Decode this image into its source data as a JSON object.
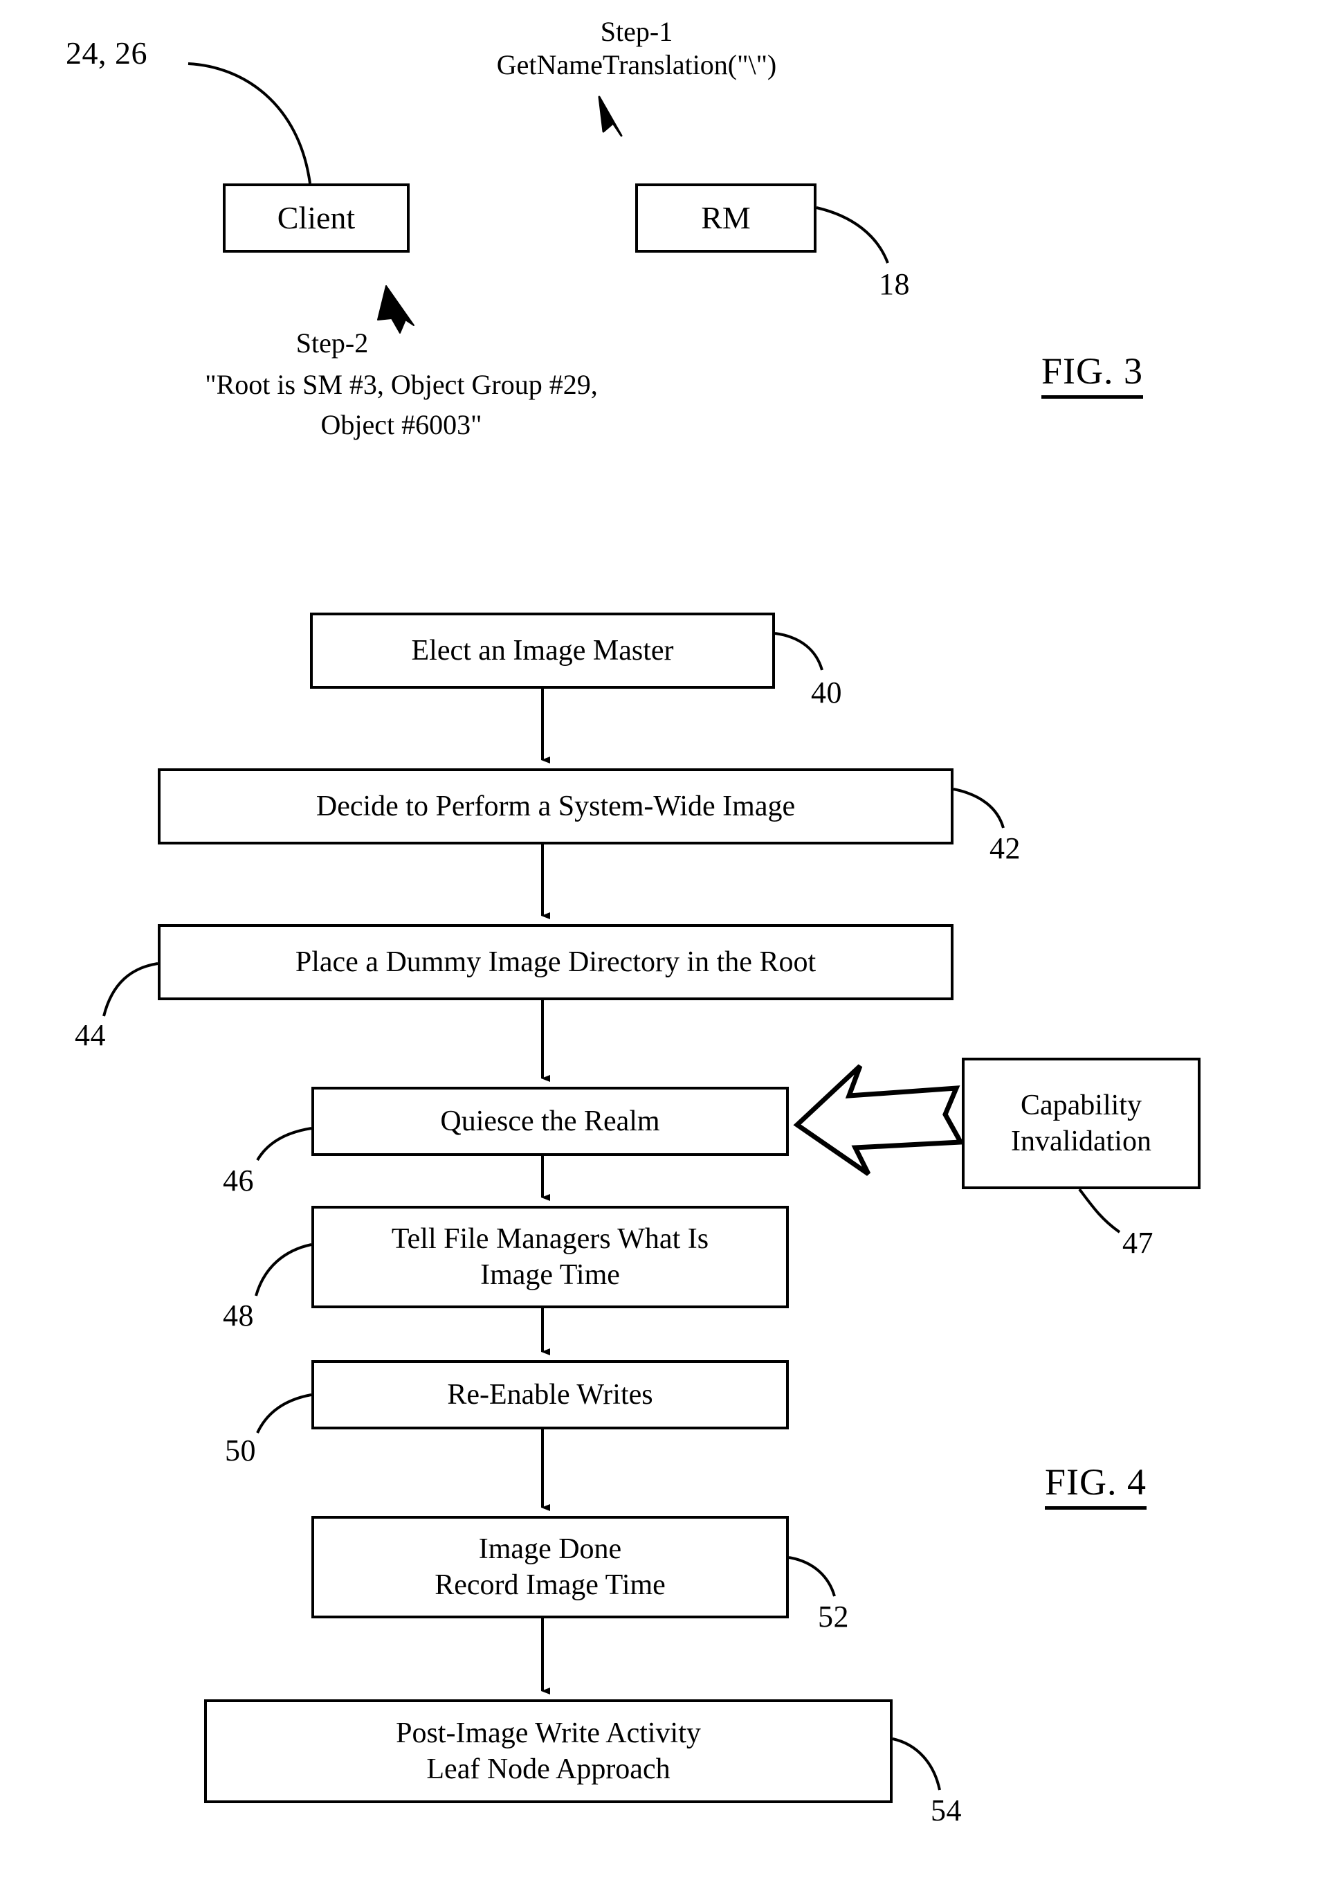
{
  "document": {
    "kind": "patent-drawing-sheet",
    "figures": [
      "FIG. 3",
      "FIG. 4"
    ]
  },
  "fig3": {
    "label": "FIG. 3",
    "step1": {
      "title": "Step-1",
      "call": "GetNameTranslation(\"\\\")"
    },
    "step2": {
      "title": "Step-2",
      "line1": "\"Root is SM #3, Object Group #29,",
      "line2": "Object #6003\""
    },
    "boxes": [
      {
        "id": "client",
        "label": "Client"
      },
      {
        "id": "rm",
        "label": "RM"
      }
    ],
    "refs": [
      {
        "id": "client-ref",
        "label": "24, 26"
      },
      {
        "id": "rm-ref",
        "label": "18"
      }
    ]
  },
  "fig4": {
    "label": "FIG. 4",
    "steps": [
      {
        "id": "elect-image-master",
        "ref": "40",
        "lines": [
          "Elect an Image Master"
        ]
      },
      {
        "id": "decide-system-wide-image",
        "ref": "42",
        "lines": [
          "Decide to Perform a System-Wide Image"
        ]
      },
      {
        "id": "place-dummy-image-directory",
        "ref": "44",
        "lines": [
          "Place a Dummy Image Directory in the Root"
        ]
      },
      {
        "id": "quiesce-the-realm",
        "ref": "46",
        "lines": [
          "Quiesce the Realm"
        ]
      },
      {
        "id": "tell-file-managers",
        "ref": "48",
        "lines": [
          "Tell File Managers What Is",
          "Image Time"
        ]
      },
      {
        "id": "re-enable-writes",
        "ref": "50",
        "lines": [
          "Re-Enable Writes"
        ]
      },
      {
        "id": "image-done",
        "ref": "52",
        "lines": [
          "Image Done",
          "Record Image Time"
        ]
      },
      {
        "id": "post-image-write-activity",
        "ref": "54",
        "lines": [
          "Post-Image Write Activity",
          "Leaf Node Approach"
        ]
      }
    ],
    "side": {
      "id": "capability-invalidation",
      "ref": "47",
      "lines": [
        "Capability",
        "Invalidation"
      ]
    }
  },
  "colors": {
    "ink": "#000000",
    "paper": "#ffffff"
  }
}
